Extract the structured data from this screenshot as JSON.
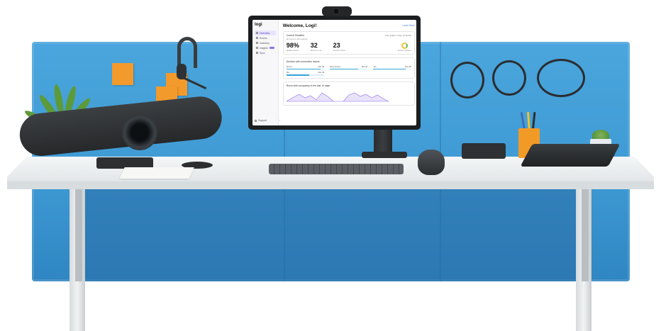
{
  "scene": {
    "colors": {
      "divider_blue": "#3f9ad4",
      "desk_white": "#eef0f1",
      "sticky_orange": "#f39a2c",
      "device_graphite": "#2d2f31",
      "accent_purple": "#4b2fd1"
    }
  },
  "dashboard": {
    "logo": "logi",
    "welcome": "Welcome, Logi!",
    "top_link": "Learn More",
    "sidebar": {
      "items": [
        {
          "label": "Overview",
          "icon": "home-icon",
          "active": true
        },
        {
          "label": "Rooms",
          "icon": "room-icon"
        },
        {
          "label": "Inventory",
          "icon": "inventory-icon"
        },
        {
          "label": "Insights",
          "icon": "insights-icon",
          "badge": true
        },
        {
          "label": "Sync",
          "icon": "sync-icon"
        }
      ],
      "footer": "Support"
    },
    "health_card": {
      "title": "Current Situation",
      "subtitle": "All rooms in all locations",
      "right": "Last update: Today, 10:00 AM",
      "stats": [
        {
          "value": "98%",
          "label": "Healthy Rooms"
        },
        {
          "value": "32",
          "label": "Rooms in use"
        },
        {
          "value": "23",
          "label": "Devices Online"
        }
      ],
      "ring_label": "System Updates"
    },
    "devices_card": {
      "title": "Devices with connection issues",
      "bars": [
        {
          "label": "Rooms",
          "value": "Max 98",
          "fill": 0.9
        },
        {
          "label": "Rally System",
          "value": "Max 64",
          "fill": 0.75
        },
        {
          "label": "Tap",
          "value": "Max 88",
          "fill": 0.85
        },
        {
          "label": "Mic",
          "value": "Max 48",
          "fill": 0.6
        }
      ]
    },
    "usage_card": {
      "title": "Room with occupancy in the last 14 days"
    }
  }
}
